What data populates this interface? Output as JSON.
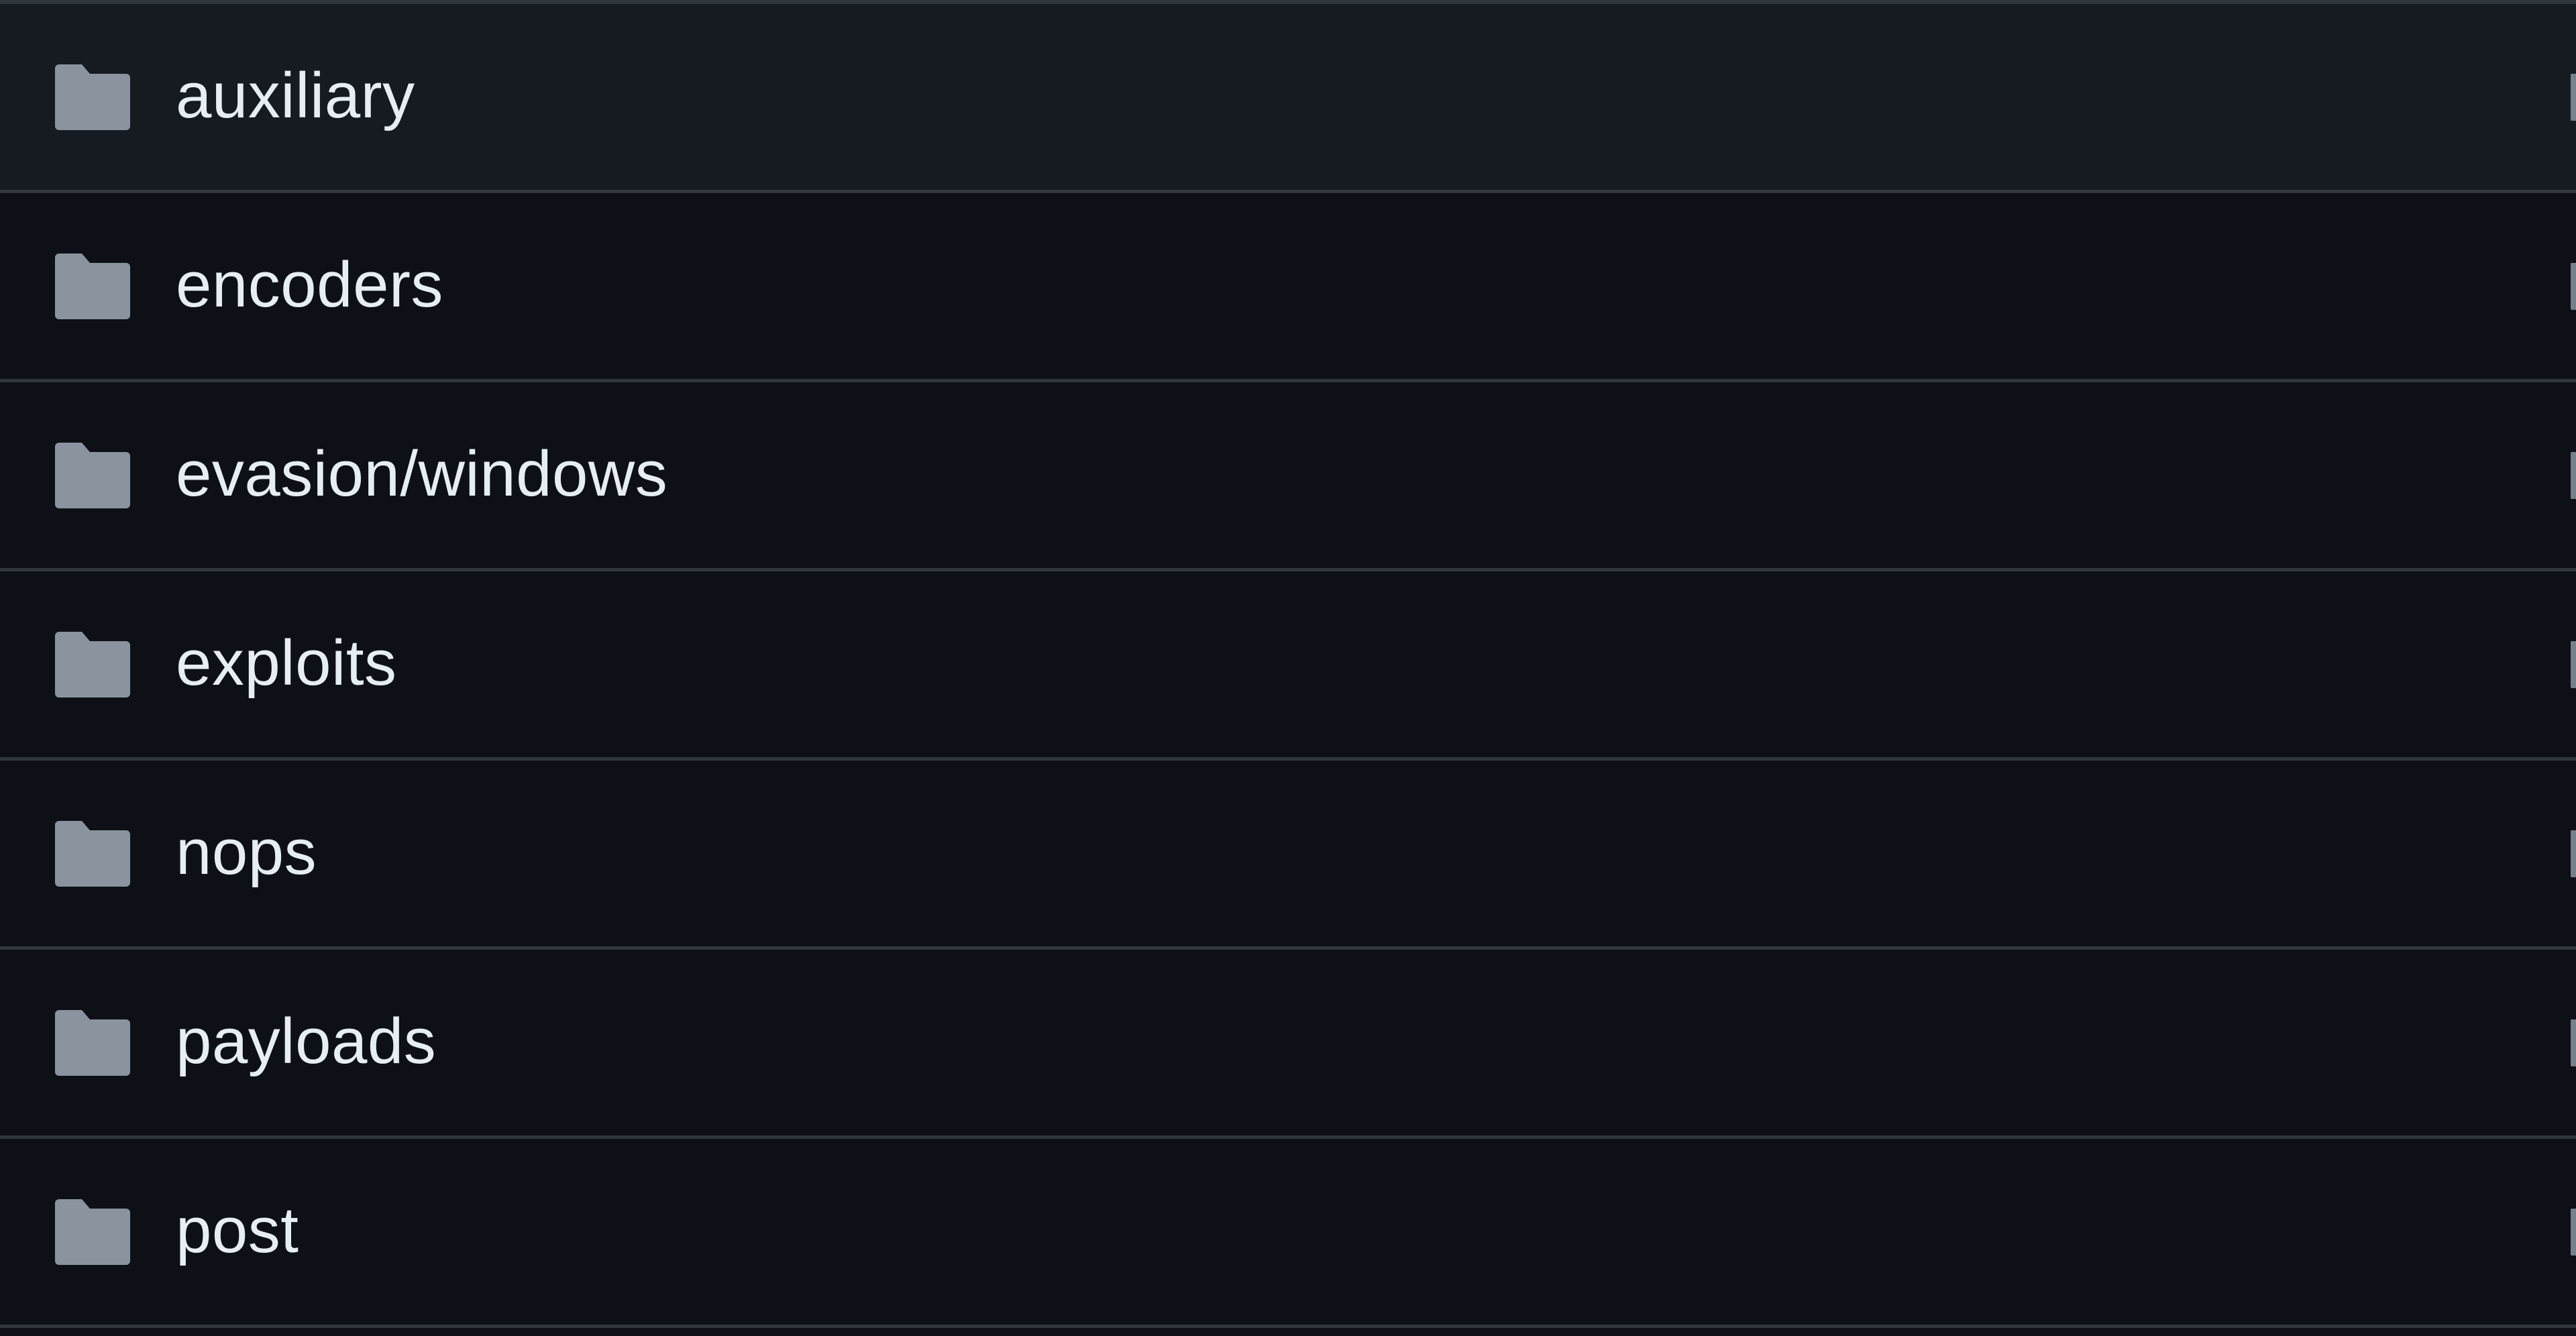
{
  "theme": {
    "background": "#0d1117",
    "row_hover_background": "#161b22",
    "border": "#30363d",
    "text": "#e6edf3",
    "icon": "#8b949e"
  },
  "file_list": {
    "items": [
      {
        "name": "auxiliary",
        "type": "directory",
        "icon": "folder-icon",
        "hovered": true
      },
      {
        "name": "encoders",
        "type": "directory",
        "icon": "folder-icon",
        "hovered": false
      },
      {
        "name": "evasion/windows",
        "type": "directory",
        "icon": "folder-icon",
        "hovered": false
      },
      {
        "name": "exploits",
        "type": "directory",
        "icon": "folder-icon",
        "hovered": false
      },
      {
        "name": "nops",
        "type": "directory",
        "icon": "folder-icon",
        "hovered": false
      },
      {
        "name": "payloads",
        "type": "directory",
        "icon": "folder-icon",
        "hovered": false
      },
      {
        "name": "post",
        "type": "directory",
        "icon": "folder-icon",
        "hovered": false
      }
    ]
  }
}
